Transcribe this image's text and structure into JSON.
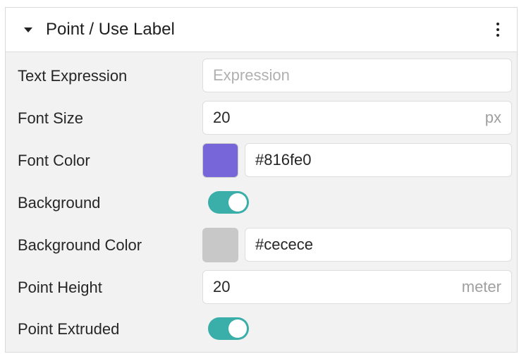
{
  "panel": {
    "title": "Point / Use Label",
    "caret_icon": "caret-down-icon",
    "menu_icon": "more-vertical-icon"
  },
  "fields": {
    "text_expression": {
      "label": "Text Expression",
      "value": "",
      "placeholder": "Expression"
    },
    "font_size": {
      "label": "Font Size",
      "value": "20",
      "unit": "px"
    },
    "font_color": {
      "label": "Font Color",
      "value": "#816fe0",
      "swatch_color": "#7766d9"
    },
    "background": {
      "label": "Background",
      "enabled": true
    },
    "background_color": {
      "label": "Background Color",
      "value": "#cecece",
      "swatch_color": "#c8c8c8"
    },
    "point_height": {
      "label": "Point Height",
      "value": "20",
      "unit": "meter"
    },
    "point_extruded": {
      "label": "Point Extruded",
      "enabled": true
    }
  },
  "colors": {
    "toggle_on": "#3aaea8"
  }
}
